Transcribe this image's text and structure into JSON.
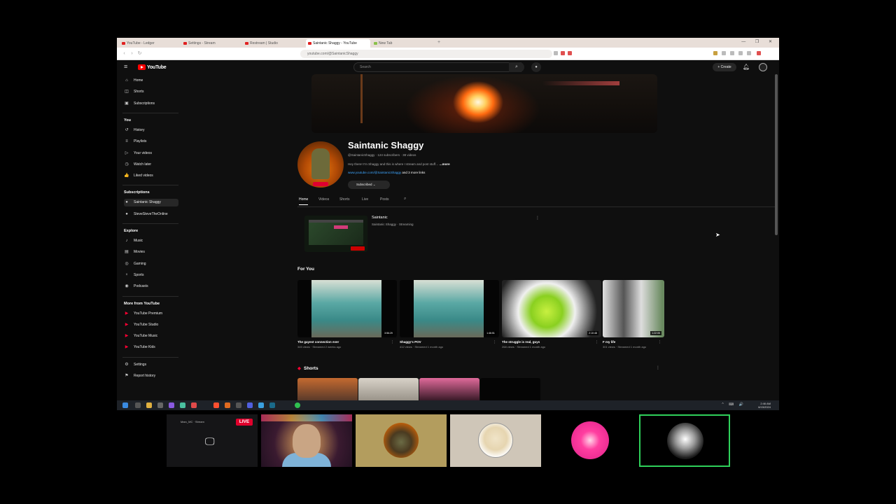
{
  "browser": {
    "tabs": [
      {
        "label": "YouTube - Ledger"
      },
      {
        "label": "Settings - Stream"
      },
      {
        "label": "Restream | Studio"
      },
      {
        "label": "Saintanic Shaggy - YouTube"
      },
      {
        "label": "New Tab"
      }
    ],
    "url": "youtube.com/@SaintanicShaggy",
    "window_controls": "— ❐ ✕"
  },
  "youtube": {
    "logo_text": "YouTube",
    "search_placeholder": "Search",
    "create_label": "+ Create",
    "sidebar": {
      "main_items": [
        {
          "icon": "home-icon",
          "glyph": "⌂",
          "label": "Home"
        },
        {
          "icon": "shorts-icon",
          "glyph": "◫",
          "label": "Shorts"
        },
        {
          "icon": "subscriptions-icon",
          "glyph": "▣",
          "label": "Subscriptions"
        }
      ],
      "you_heading": "You",
      "you_items": [
        {
          "icon": "history-icon",
          "glyph": "↺",
          "label": "History"
        },
        {
          "icon": "playlists-icon",
          "glyph": "≡",
          "label": "Playlists"
        },
        {
          "icon": "your-videos-icon",
          "glyph": "▷",
          "label": "Your videos"
        },
        {
          "icon": "watch-later-icon",
          "glyph": "◷",
          "label": "Watch later"
        },
        {
          "icon": "liked-videos-icon",
          "glyph": "👍",
          "label": "Liked videos"
        }
      ],
      "subscriptions_heading": "Subscriptions",
      "subscriptions_items": [
        {
          "icon": "channel-avatar-icon",
          "glyph": "●",
          "label": "Saintanic Shaggy"
        },
        {
          "icon": "channel-avatar-icon",
          "glyph": "●",
          "label": "SteveSteveTheOnline"
        }
      ],
      "explore_heading": "Explore",
      "explore_items": [
        {
          "icon": "music-icon",
          "glyph": "♪",
          "label": "Music"
        },
        {
          "icon": "movies-icon",
          "glyph": "▤",
          "label": "Movies"
        },
        {
          "icon": "gaming-icon",
          "glyph": "◎",
          "label": "Gaming"
        },
        {
          "icon": "sports-icon",
          "glyph": "♆",
          "label": "Sports"
        },
        {
          "icon": "podcasts-icon",
          "glyph": "◉",
          "label": "Podcasts"
        }
      ],
      "more_heading": "More from YouTube",
      "more_items": [
        {
          "icon": "youtube-premium-icon",
          "glyph": "▶",
          "label": "YouTube Premium"
        },
        {
          "icon": "youtube-studio-icon",
          "glyph": "▶",
          "label": "YouTube Studio"
        },
        {
          "icon": "youtube-music-icon",
          "glyph": "▶",
          "label": "YouTube Music"
        },
        {
          "icon": "youtube-kids-icon",
          "glyph": "▶",
          "label": "YouTube Kids"
        }
      ],
      "bottom_items": [
        {
          "icon": "settings-icon",
          "glyph": "⚙",
          "label": "Settings"
        },
        {
          "icon": "report-history-icon",
          "glyph": "⚑",
          "label": "Report history"
        }
      ]
    },
    "channel": {
      "name": "Saintanic Shaggy",
      "meta": "@SaintanicShaggy · 124 subscribers · 38 videos",
      "description": "Hey there! I'm Shaggy and this is where I stream and post stuff…",
      "more_label": "...more",
      "link": "www.youtube.com/@SaintanicShaggy",
      "link_more": "and 3 more links",
      "subscribed_label": "Subscribed",
      "tabs": [
        "Home",
        "Videos",
        "Shorts",
        "Live",
        "Posts"
      ]
    },
    "live": {
      "title": "Saintanic",
      "subtitle": "Saintanic Shaggy · Streaming"
    },
    "for_you_heading": "For You",
    "videos": [
      {
        "title": "The gayest connection ever",
        "meta": "345 views · Streamed 2 weeks ago",
        "duration": "3:56:29"
      },
      {
        "title": "Shaggy's POV",
        "meta": "412 views · Streamed 1 month ago",
        "duration": "1:46:51"
      },
      {
        "title": "The struggle is real, guys",
        "meta": "268 views · Streamed 1 month ago",
        "duration": "2:10:48"
      },
      {
        "title": "F my life",
        "meta": "301 views · Streamed 1 month ago",
        "duration": "1:22:05"
      }
    ],
    "shorts_heading": "Shorts"
  },
  "taskbar": {
    "clock_time": "2:46 AM",
    "clock_date": "6/15/2024",
    "tray": "^ ⌨ 🔊"
  },
  "participants": {
    "live_badge": "LIVE",
    "tile1_label": "Marc_MC · Stream"
  },
  "colors": {
    "youtube_red": "#ff0000",
    "live_red": "#e0002c",
    "speaking_green": "#2fd05a",
    "link_blue": "#3ea6ff"
  }
}
